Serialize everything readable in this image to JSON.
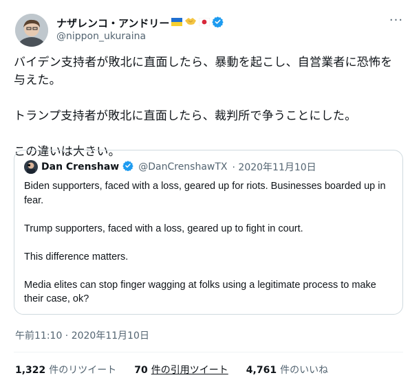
{
  "author": {
    "display_name": "ナザレンコ・アンドリー",
    "handle": "@nippon_ukuraina",
    "verified": true,
    "name_emoji": [
      "ukraine-flag",
      "handshake",
      "japan-flag"
    ]
  },
  "tweet": {
    "text": "バイデン支持者が敗北に直面したら、暴動を起こし、自営業者に恐怖を与えた。\n\nトランプ支持者が敗北に直面したら、裁判所で争うことにした。\n\nこの違いは大きい。",
    "timestamp": "午前11:10 · 2020年11月10日"
  },
  "quoted": {
    "display_name": "Dan Crenshaw",
    "handle": "@DanCrenshawTX",
    "date": "· 2020年11月10日",
    "verified": true,
    "text": "Biden supporters, faced with a loss, geared up for riots. Businesses boarded up in fear.\n\nTrump supporters, faced with a loss, geared up to fight in court.\n\nThis difference matters.\n\nMedia elites can stop finger wagging at folks using a legitimate process to make their case, ok?"
  },
  "stats": {
    "retweets_count": "1,322",
    "retweets_label": "件のリツイート",
    "quotes_count": "70",
    "quotes_label": "件の引用ツイート",
    "likes_count": "4,761",
    "likes_label": "件のいいね"
  },
  "colors": {
    "text": "#0f1419",
    "secondary": "#536471",
    "border": "#cfd9de",
    "verified": "#1d9bf0"
  }
}
